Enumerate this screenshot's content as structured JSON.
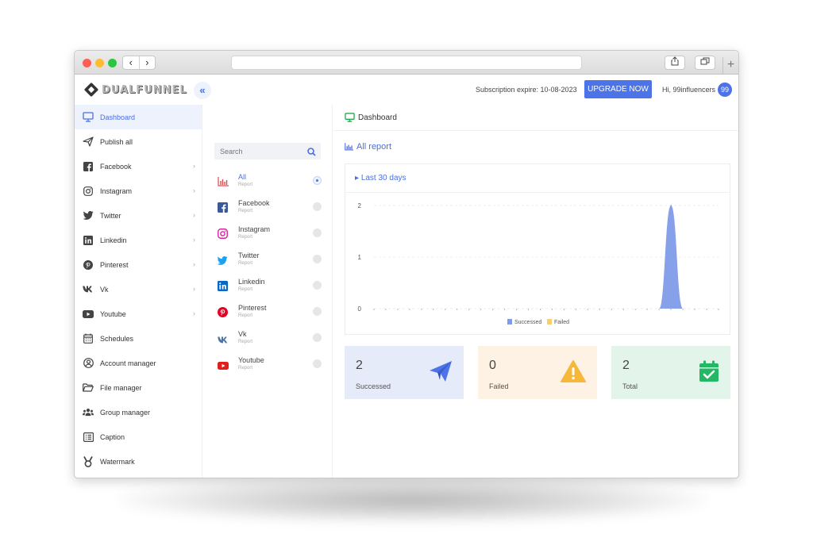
{
  "browser": {
    "back": "‹",
    "forward": "›",
    "new_tab": "+"
  },
  "header": {
    "logo_text": "DUALFUNNEL",
    "collapse_icon": "«",
    "subscription": "Subscription expire: 10-08-2023",
    "upgrade_label": "UPGRADE NOW",
    "greeting": "Hi, 99influencers",
    "avatar_badge": "99"
  },
  "sidebar": {
    "items": [
      {
        "label": "Dashboard",
        "icon": "monitor-icon",
        "chevron": false
      },
      {
        "label": "Publish all",
        "icon": "send-icon",
        "chevron": false
      },
      {
        "label": "Facebook",
        "icon": "facebook-icon",
        "chevron": true
      },
      {
        "label": "Instagram",
        "icon": "instagram-icon",
        "chevron": true
      },
      {
        "label": "Twitter",
        "icon": "twitter-icon",
        "chevron": true
      },
      {
        "label": "Linkedin",
        "icon": "linkedin-icon",
        "chevron": true
      },
      {
        "label": "Pinterest",
        "icon": "pinterest-icon",
        "chevron": true
      },
      {
        "label": "Vk",
        "icon": "vk-icon",
        "chevron": true
      },
      {
        "label": "Youtube",
        "icon": "youtube-icon",
        "chevron": true
      },
      {
        "label": "Schedules",
        "icon": "calendar-icon",
        "chevron": false
      },
      {
        "label": "Account manager",
        "icon": "user-circle-icon",
        "chevron": false
      },
      {
        "label": "File manager",
        "icon": "folder-icon",
        "chevron": false
      },
      {
        "label": "Group manager",
        "icon": "users-icon",
        "chevron": false
      },
      {
        "label": "Caption",
        "icon": "list-icon",
        "chevron": false
      },
      {
        "label": "Watermark",
        "icon": "award-icon",
        "chevron": false
      }
    ],
    "chevron_glyph": "›"
  },
  "filter": {
    "search_placeholder": "Search",
    "items": [
      {
        "label": "All",
        "sub": "Report",
        "icon": "bar-chart-icon",
        "selected": true
      },
      {
        "label": "Facebook",
        "sub": "Report",
        "icon": "facebook-icon",
        "selected": false
      },
      {
        "label": "Instagram",
        "sub": "Report",
        "icon": "instagram-icon",
        "selected": false
      },
      {
        "label": "Twitter",
        "sub": "Report",
        "icon": "twitter-icon",
        "selected": false
      },
      {
        "label": "Linkedin",
        "sub": "Report",
        "icon": "linkedin-icon",
        "selected": false
      },
      {
        "label": "Pinterest",
        "sub": "Report",
        "icon": "pinterest-icon",
        "selected": false
      },
      {
        "label": "Vk",
        "sub": "Report",
        "icon": "vk-icon",
        "selected": false
      },
      {
        "label": "Youtube",
        "sub": "Report",
        "icon": "youtube-icon",
        "selected": false
      }
    ]
  },
  "main": {
    "title": "Dashboard",
    "section_title": "All report",
    "range_label": "Last 30 days",
    "stats": [
      {
        "value": "2",
        "label": "Successed",
        "icon": "paper-plane-icon",
        "color": "#4d73e8"
      },
      {
        "value": "0",
        "label": "Failed",
        "icon": "warning-icon",
        "color": "#f6b83b"
      },
      {
        "value": "2",
        "label": "Total",
        "icon": "calendar-check-icon",
        "color": "#22b864"
      }
    ]
  },
  "colors": {
    "accent": "#4d73e8",
    "success_series": "#7f9be9",
    "failed_series": "#f7cf6e"
  },
  "chart_data": {
    "type": "area",
    "title": "",
    "xlabel": "",
    "ylabel": "",
    "ylim": [
      0,
      2
    ],
    "yticks": [
      "0",
      "1",
      "2"
    ],
    "point_count": 30,
    "series": [
      {
        "name": "Successed",
        "values": [
          0,
          0,
          0,
          0,
          0,
          0,
          0,
          0,
          0,
          0,
          0,
          0,
          0,
          0,
          0,
          0,
          0,
          0,
          0,
          0,
          0,
          0,
          0,
          0,
          0,
          2,
          0,
          0,
          0,
          0
        ]
      },
      {
        "name": "Failed",
        "values": [
          0,
          0,
          0,
          0,
          0,
          0,
          0,
          0,
          0,
          0,
          0,
          0,
          0,
          0,
          0,
          0,
          0,
          0,
          0,
          0,
          0,
          0,
          0,
          0,
          0,
          0,
          0,
          0,
          0,
          0
        ]
      }
    ],
    "legend_position": "bottom",
    "grid": true
  }
}
